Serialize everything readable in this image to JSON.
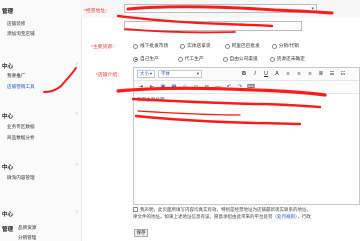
{
  "sidebar": {
    "groups": [
      {
        "heading": "管理",
        "items": [
          "店铺装修",
          "添加淘宝店铺"
        ]
      },
      {
        "heading": "中心",
        "items": [
          "我要推广",
          "店铺营销工具"
        ]
      },
      {
        "heading": "中心",
        "items": [
          "业务专区数据",
          "商品数据分析"
        ]
      },
      {
        "heading": "中心",
        "items": [
          "微淘内容管理"
        ]
      },
      {
        "heading": "中心",
        "items": []
      },
      {
        "heading": "管理",
        "items": [
          "品牌资源",
          "分销管理"
        ]
      }
    ],
    "prefix_labels": [
      "店铺"
    ]
  },
  "form": {
    "address_label": "*经营地址：",
    "source_label": "*主要货源：",
    "intro_label": "*店铺介绍：",
    "sources_row1": [
      "线下批发市场",
      "实体店拿货",
      "阿里巴巴批发",
      "分销/代销"
    ],
    "sources_row2": [
      "自己生产",
      "代工生产",
      "自由公司渠道",
      "货源还未确定"
    ],
    "selected_source": "自己生产"
  },
  "editor": {
    "fontsize_label": "大小",
    "fontface_label": "字体",
    "body_text": "我家主要经营……"
  },
  "footer": {
    "agree_line1": "我声明，此页面所填写内容均真实有效，特别是经营地址为店铺最新现实联系的地址，",
    "agree_line2": "律文件的地址。如果上述地址信息有误，愿意承担由此带来的平台处罚（",
    "agree_link": "处罚规则",
    "agree_tail": "），行政",
    "save_label": "保存"
  }
}
